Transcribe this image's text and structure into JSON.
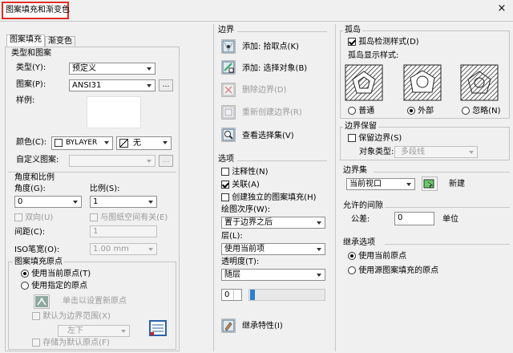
{
  "window": {
    "title": "图案填充和渐变色",
    "close_glyph": "×"
  },
  "tabs": [
    "图案填充",
    "渐变色"
  ],
  "pattern": {
    "section_title": "类型和图案",
    "type_label": "类型(Y):",
    "type_value": "预定义",
    "pattern_label": "图案(P):",
    "pattern_value": "ANSI31",
    "swatch_label": "样例:",
    "color_label": "颜色(C):",
    "color_value": "BYLAYER",
    "bg_value": "无",
    "custom_label": "自定义图案:"
  },
  "angle": {
    "section_title": "角度和比例",
    "angle_label": "角度(G):",
    "angle_value": "0",
    "scale_label": "比例(S):",
    "scale_value": "1",
    "double_label": "双向(U)",
    "relative_label": "与图纸空间有关(E)",
    "spacing_label": "间距(C):",
    "spacing_value": "1",
    "iso_label": "ISO笔宽(O):",
    "iso_value": "1.00 mm"
  },
  "origin": {
    "section_title": "图案填充原点",
    "current_label": "使用当前原点(T)",
    "specified_label": "使用指定的原点",
    "click_label": "单击以设置新原点",
    "default_label": "默认为边界范围(X)",
    "position_value": "左下",
    "store_label": "存储为默认原点(F)"
  },
  "boundary": {
    "section_title": "边界",
    "add_pick": "添加: 拾取点(K)",
    "add_select": "添加: 选择对象(B)",
    "remove": "删除边界(D)",
    "recreate": "重新创建边界(R)",
    "view": "查看选择集(V)"
  },
  "options": {
    "section_title": "选项",
    "annotative": "注释性(N)",
    "associative": "关联(A)",
    "separate": "创建独立的图案填充(H)",
    "draw_order_label": "绘图次序(W):",
    "draw_order_value": "置于边界之后",
    "layer_label": "层(L):",
    "layer_value": "使用当前项",
    "transparency_label": "透明度(T):",
    "transparency_value": "随层",
    "transparency_num": "0"
  },
  "inherit_label": "继承特性(I)",
  "islands": {
    "section_title": "孤岛",
    "detect_label": "孤岛检测样式(D)",
    "style_label": "孤岛显示样式:",
    "normal_label": "普通",
    "outer_label": "外部",
    "ignore_label": "忽略(N)"
  },
  "retain": {
    "section_title": "边界保留",
    "retain_label": "保留边界(S)",
    "type_label": "对象类型:",
    "type_value": "多段线"
  },
  "boundary_set": {
    "section_title": "边界集",
    "value": "当前视口",
    "new_label": "新建"
  },
  "gap": {
    "section_title": "允许的间隙",
    "tolerance_label": "公差:",
    "tolerance_value": "0",
    "unit_label": "单位"
  },
  "inherit_options": {
    "section_title": "继承选项",
    "current_label": "使用当前原点",
    "source_label": "使用源图案填充的原点"
  },
  "colors": {
    "highlight": "#e03020",
    "accent": "#2a7fd4"
  }
}
